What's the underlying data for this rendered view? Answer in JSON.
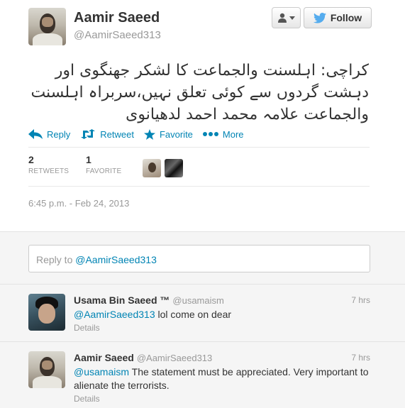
{
  "tweet": {
    "author": {
      "name": "Aamir Saeed",
      "handle": "@AamirSaeed313"
    },
    "follow_label": "Follow",
    "text": "کراچی: اہلسنت والجماعت کا لشکر جھنگوی اور دہشت گردوں سے کوئی تعلق نہیں،سربراہ اہلسنت والجماعت علامہ محمد احمد لدھیانوی",
    "actions": {
      "reply": "Reply",
      "retweet": "Retweet",
      "favorite": "Favorite",
      "more": "More"
    },
    "stats": {
      "retweets": {
        "count": "2",
        "label": "RETWEETS"
      },
      "favorites": {
        "count": "1",
        "label": "FAVORITE"
      }
    },
    "timestamp": "6:45 p.m. - Feb 24, 2013"
  },
  "reply_box": {
    "prefix": "Reply to ",
    "mention": "@AamirSaeed313"
  },
  "replies": [
    {
      "name": "Usama Bin Saeed ™",
      "handle": "@usamaism",
      "time": "7 hrs",
      "mention": "@AamirSaeed313",
      "text": " lol come on dear",
      "details": "Details"
    },
    {
      "name": "Aamir Saeed",
      "handle": "@AamirSaeed313",
      "time": "7 hrs",
      "mention": "@usamaism",
      "text": " The statement must be appreciated. Very important to alienate the terrorists.",
      "details": "Details"
    }
  ],
  "colors": {
    "link": "#0084b4",
    "muted": "#999999",
    "text": "#333333",
    "twitter_bird": "#55acee"
  }
}
